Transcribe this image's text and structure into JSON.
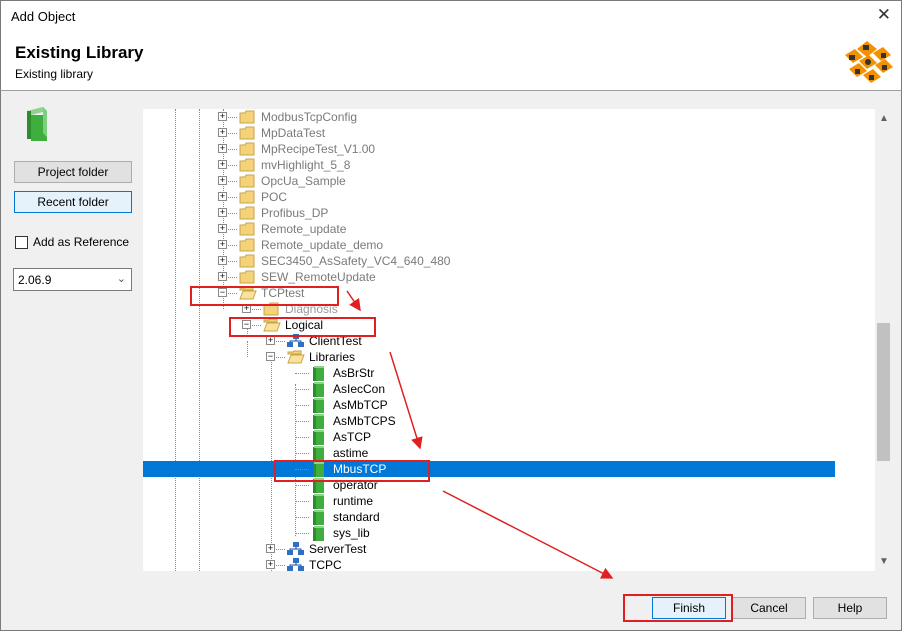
{
  "window": {
    "title": "Add Object",
    "close_glyph": "✕"
  },
  "header": {
    "title": "Existing Library",
    "subtitle": "Existing library"
  },
  "left_panel": {
    "project_folder_label": "Project folder",
    "recent_folder_label": "Recent folder",
    "add_reference_label": "Add as Reference",
    "version_value": "2.06.9"
  },
  "tree": {
    "items": [
      "ModbusTcpConfig",
      "MpDataTest",
      "MpRecipeTest_V1.00",
      "mvHighlight_5_8",
      "OpcUa_Sample",
      "POC",
      "Profibus_DP",
      "Remote_update",
      "Remote_update_demo",
      "SEC3450_AsSafety_VC4_640_480",
      "SEW_RemoteUpdate",
      "TCPtest",
      "Diagnosis",
      "Logical",
      "ClientTest",
      "Libraries",
      "AsBrStr",
      "AsIecCon",
      "AsMbTCP",
      "AsMbTCPS",
      "AsTCP",
      "astime",
      "MbusTCP",
      "operator",
      "runtime",
      "standard",
      "sys_lib",
      "ServerTest",
      "TCPC"
    ]
  },
  "buttons": {
    "finish": "Finish",
    "cancel": "Cancel",
    "help": "Help"
  },
  "colors": {
    "selection": "#0078d7",
    "annotation": "#e02020",
    "folder": "#f4d27a",
    "library": "#3fae3f"
  }
}
